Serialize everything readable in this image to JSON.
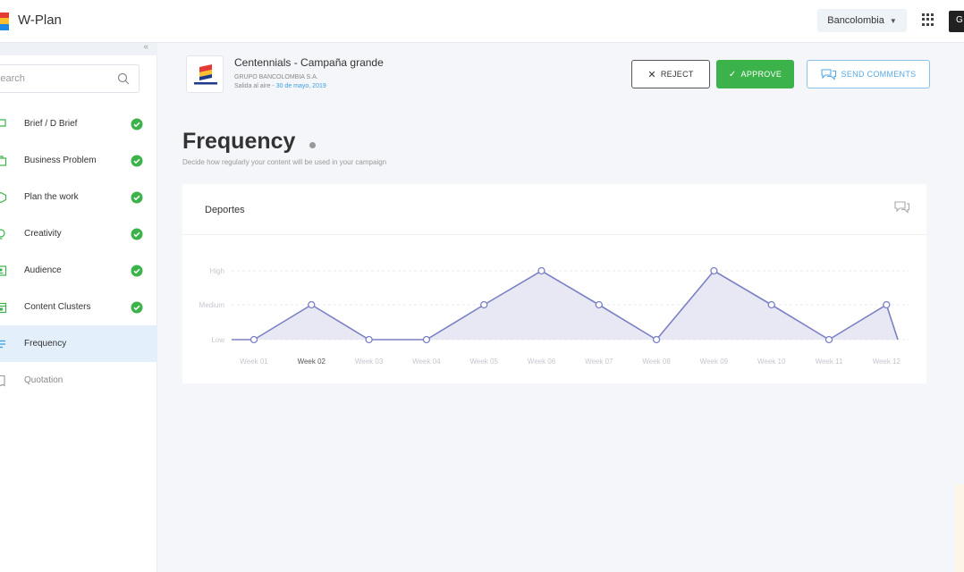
{
  "app": {
    "title": "W-Plan"
  },
  "topbar": {
    "organization": "Bancolombia",
    "user_initial": "G"
  },
  "sidebar": {
    "search_placeholder": "Search",
    "items": [
      {
        "label": "Brief / D Brief",
        "icon": "chat-icon",
        "completed": true
      },
      {
        "label": "Business Problem",
        "icon": "briefcase-icon",
        "completed": true
      },
      {
        "label": "Plan the work",
        "icon": "box-icon",
        "completed": true
      },
      {
        "label": "Creativity",
        "icon": "lightbulb-icon",
        "completed": true
      },
      {
        "label": "Audience",
        "icon": "id-card-icon",
        "completed": true
      },
      {
        "label": "Content Clusters",
        "icon": "calendar-icon",
        "completed": true
      },
      {
        "label": "Frequency",
        "icon": "list-icon",
        "completed": false,
        "active": true
      },
      {
        "label": "Quotation",
        "icon": "receipt-icon",
        "completed": false
      }
    ]
  },
  "campaign": {
    "title": "Centennials - Campaña grande",
    "company": "GRUPO BANCOLOMBIA S.A.",
    "air_label": "Salida al aire - ",
    "air_date": "30 de mayo, 2019"
  },
  "actions": {
    "reject": "REJECT",
    "approve": "APPROVE",
    "send_comments": "SEND COMMENTS"
  },
  "page": {
    "title": "Frequency",
    "subtitle": "Decide how regularly your content will be used in your campaign"
  },
  "card": {
    "title": "Deportes"
  },
  "colors": {
    "accent": "#3b9fe0",
    "approve": "#3bb34a",
    "line": "#7b80c4",
    "area": "#e4e5f2"
  },
  "chart_data": {
    "type": "area",
    "categories": [
      "Week 01",
      "Week 02",
      "Week 03",
      "Week 04",
      "Week 05",
      "Week 06",
      "Week 07",
      "Week 08",
      "Week 09",
      "Week 10",
      "Week 11",
      "Week 12"
    ],
    "levels": [
      "Low",
      "Medium",
      "High"
    ],
    "values": [
      "Low",
      "Medium",
      "Low",
      "Low",
      "Medium",
      "High",
      "Medium",
      "Low",
      "High",
      "Medium",
      "Low",
      "Medium"
    ],
    "highlighted_category": "Week 02",
    "grid": true
  }
}
